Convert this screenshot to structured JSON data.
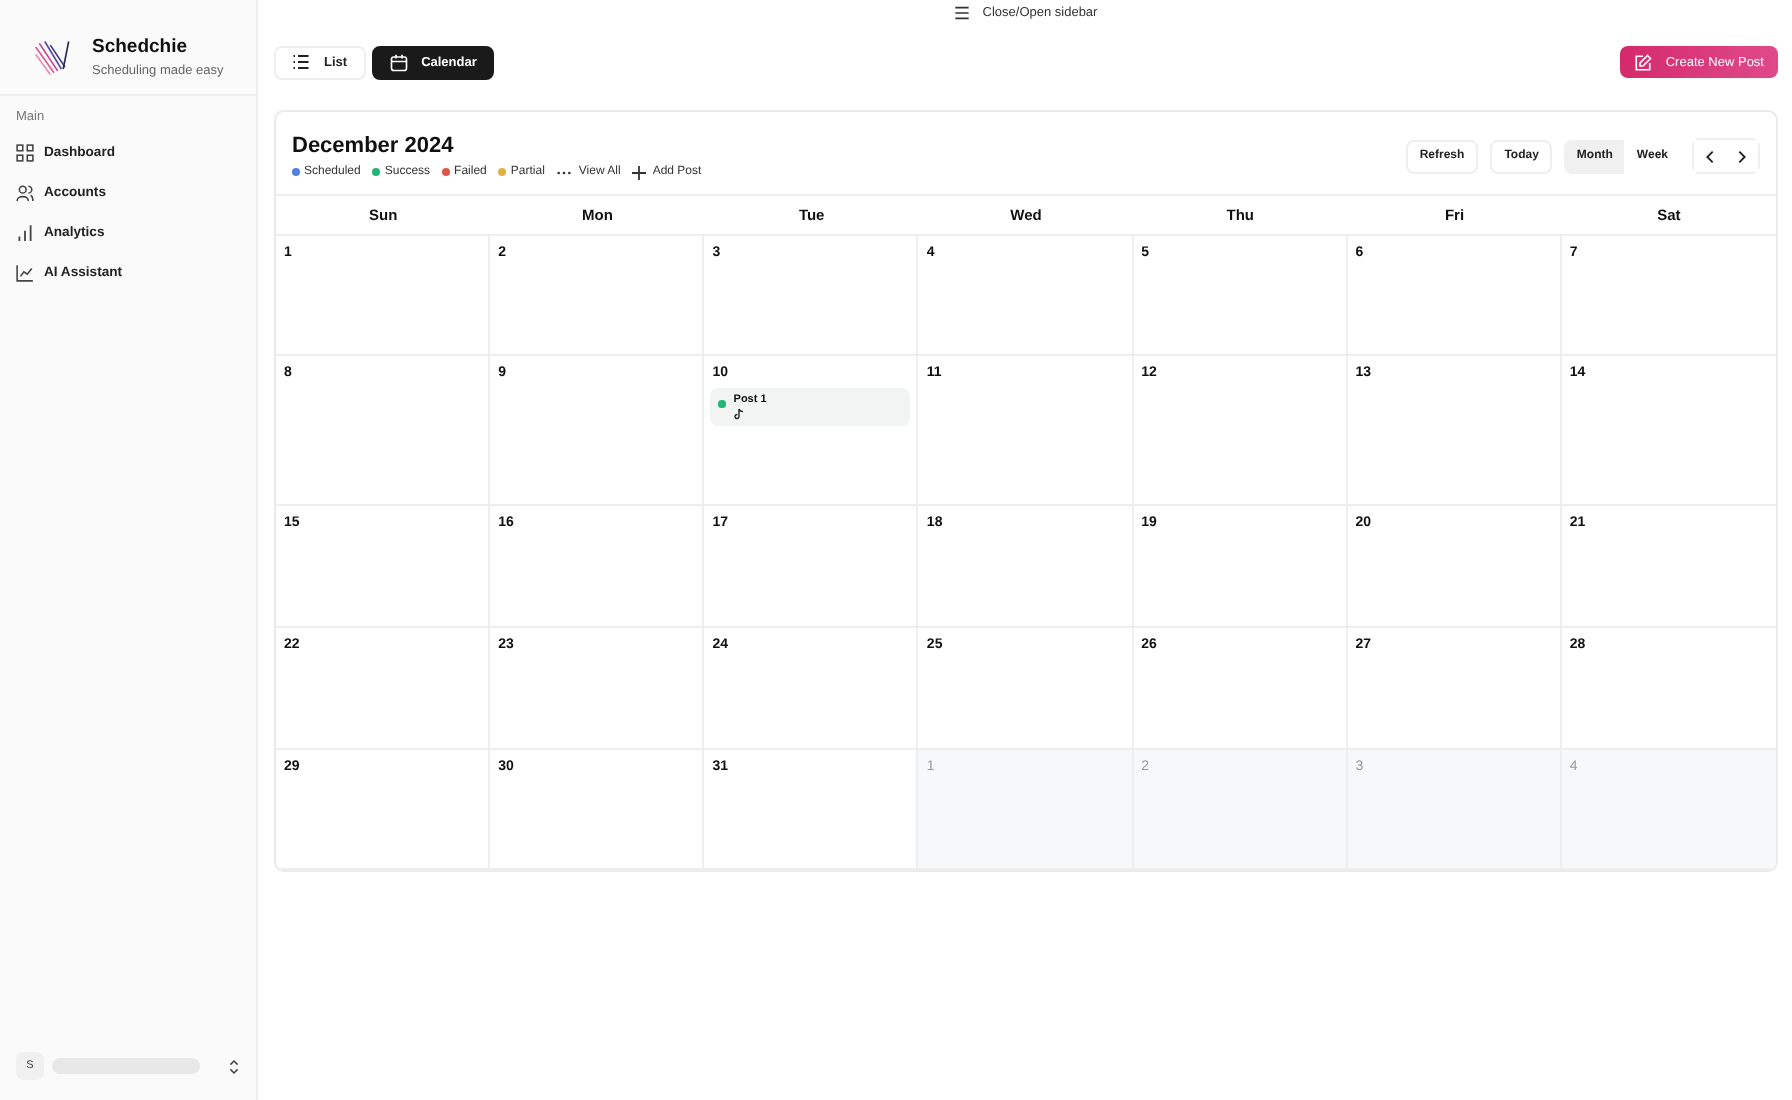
{
  "sidebar": {
    "brand": "Schedchie",
    "tagline": "Scheduling made easy",
    "section": "Main",
    "items": [
      {
        "label": "Dashboard",
        "selected": false
      },
      {
        "label": "Accounts",
        "selected": false
      },
      {
        "label": "Analytics",
        "selected": false
      },
      {
        "label": "AI Assistant",
        "selected": false
      }
    ],
    "user": {
      "initial": "S"
    }
  },
  "topbar": {
    "toggle_label": "Close/Open sidebar",
    "views": [
      {
        "label": "List",
        "selected": false
      },
      {
        "label": "Calendar",
        "selected": true
      }
    ],
    "create_button": "Create New Post"
  },
  "calendar": {
    "title": "December 2024",
    "legend": [
      {
        "label": "Scheduled",
        "color": "#4f7fe0"
      },
      {
        "label": "Success",
        "color": "#22b573"
      },
      {
        "label": "Failed",
        "color": "#e0524a"
      },
      {
        "label": "Partial",
        "color": "#e0b040"
      }
    ],
    "view_all": "View All",
    "add_post": "Add Post",
    "controls": {
      "refresh": "Refresh",
      "today": "Today",
      "modes": [
        {
          "label": "Month",
          "selected": true
        },
        {
          "label": "Week",
          "selected": false
        }
      ]
    },
    "weekdays": [
      "Sun",
      "Mon",
      "Tue",
      "Wed",
      "Thu",
      "Fri",
      "Sat"
    ],
    "weeks": [
      [
        {
          "day": "1",
          "outside": false
        },
        {
          "day": "2",
          "outside": false
        },
        {
          "day": "3",
          "outside": false
        },
        {
          "day": "4",
          "outside": false
        },
        {
          "day": "5",
          "outside": false
        },
        {
          "day": "6",
          "outside": false
        },
        {
          "day": "7",
          "outside": false
        }
      ],
      [
        {
          "day": "8",
          "outside": false
        },
        {
          "day": "9",
          "outside": false
        },
        {
          "day": "10",
          "outside": false,
          "posts": [
            {
              "title": "Post 1",
              "color": "#22b573",
              "kind": "tiktok"
            }
          ]
        },
        {
          "day": "11",
          "outside": false
        },
        {
          "day": "12",
          "outside": false
        },
        {
          "day": "13",
          "outside": false
        },
        {
          "day": "14",
          "outside": false
        }
      ],
      [
        {
          "day": "15",
          "outside": false
        },
        {
          "day": "16",
          "outside": false
        },
        {
          "day": "17",
          "outside": false
        },
        {
          "day": "18",
          "outside": false
        },
        {
          "day": "19",
          "outside": false
        },
        {
          "day": "20",
          "outside": false
        },
        {
          "day": "21",
          "outside": false
        }
      ],
      [
        {
          "day": "22",
          "outside": false
        },
        {
          "day": "23",
          "outside": false
        },
        {
          "day": "24",
          "outside": false
        },
        {
          "day": "25",
          "outside": false
        },
        {
          "day": "26",
          "outside": false
        },
        {
          "day": "27",
          "outside": false
        },
        {
          "day": "28",
          "outside": false
        }
      ],
      [
        {
          "day": "29",
          "outside": false
        },
        {
          "day": "30",
          "outside": false
        },
        {
          "day": "31",
          "outside": false
        },
        {
          "day": "1",
          "outside": true
        },
        {
          "day": "2",
          "outside": true
        },
        {
          "day": "3",
          "outside": true
        },
        {
          "day": "4",
          "outside": true
        }
      ]
    ]
  }
}
